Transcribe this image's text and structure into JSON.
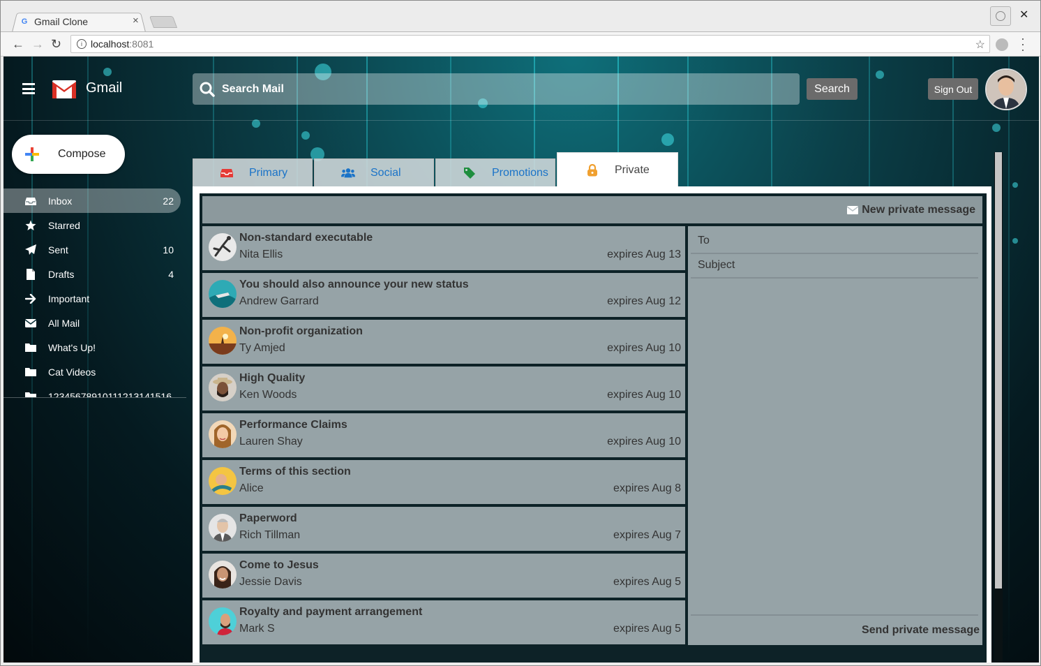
{
  "browser": {
    "tab_title": "Gmail Clone",
    "tab_favicon": "G",
    "tab_close": "×",
    "window_close": "✕",
    "url_host": "localhost",
    "url_port": ":8081",
    "star": "☆"
  },
  "header": {
    "app_name": "Gmail",
    "search_placeholder": "Search Mail",
    "search_button": "Search",
    "sign_out_button": "Sign Out"
  },
  "sidebar": {
    "compose_label": "Compose",
    "items": [
      {
        "label": "Inbox",
        "count": "22",
        "icon": "inbox-icon"
      },
      {
        "label": "Starred",
        "count": "",
        "icon": "star-icon"
      },
      {
        "label": "Sent",
        "count": "10",
        "icon": "paper-plane-icon"
      },
      {
        "label": "Drafts",
        "count": "4",
        "icon": "file-icon"
      },
      {
        "label": "Important",
        "count": "",
        "icon": "arrow-right-icon"
      },
      {
        "label": "All Mail",
        "count": "",
        "icon": "envelope-icon"
      },
      {
        "label": "What's Up!",
        "count": "",
        "icon": "folder-icon"
      },
      {
        "label": "Cat Videos",
        "count": "",
        "icon": "folder-icon"
      },
      {
        "label": "12345678910111213141516",
        "count": "",
        "icon": "folder-icon"
      }
    ]
  },
  "tabs": [
    {
      "label": "Primary",
      "icon": "inbox-icon",
      "color": "#e53935"
    },
    {
      "label": "Social",
      "icon": "users-icon",
      "color": "#1a73c8"
    },
    {
      "label": "Promotions",
      "icon": "tag-icon",
      "color": "#1e8e3e"
    },
    {
      "label": "Private",
      "icon": "lock-icon",
      "color": "#f0a030"
    }
  ],
  "private": {
    "new_message": "New private message",
    "messages": [
      {
        "subject": "Non-standard executable",
        "from": "Nita Ellis",
        "expires": "expires Aug 13"
      },
      {
        "subject": "You should also announce your new status",
        "from": "Andrew Garrard",
        "expires": "expires Aug 12"
      },
      {
        "subject": "Non-profit organization",
        "from": "Ty Amjed",
        "expires": "expires Aug 10"
      },
      {
        "subject": "High Quality",
        "from": "Ken Woods",
        "expires": "expires Aug 10"
      },
      {
        "subject": "Performance Claims",
        "from": "Lauren Shay",
        "expires": "expires Aug 10"
      },
      {
        "subject": "Terms of this section",
        "from": "Alice",
        "expires": "expires Aug 8"
      },
      {
        "subject": "Paperword",
        "from": "Rich Tillman",
        "expires": "expires Aug 7"
      },
      {
        "subject": "Come to Jesus",
        "from": "Jessie Davis",
        "expires": "expires Aug 5"
      },
      {
        "subject": "Royalty and payment arrangement",
        "from": "Mark S",
        "expires": "expires Aug 5"
      }
    ],
    "compose": {
      "to_placeholder": "To",
      "subject_placeholder": "Subject",
      "send_label": "Send private message"
    }
  }
}
